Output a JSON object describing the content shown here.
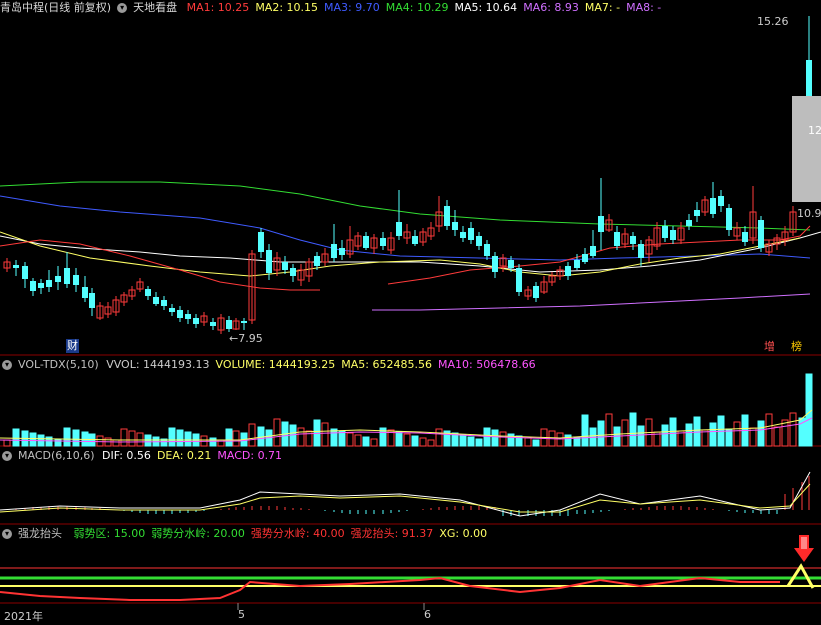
{
  "title_bar": {
    "stock": "青岛中程(日线 前复权)",
    "formula": "天地看盘"
  },
  "main_panel": {
    "ma_items": [
      {
        "text": "MA1: 10.25",
        "color": "#ff3b3b"
      },
      {
        "text": "MA2: 10.15",
        "color": "#ffff66"
      },
      {
        "text": "MA3: 9.70",
        "color": "#3f5bff"
      },
      {
        "text": "MA4: 10.29",
        "color": "#33dd33"
      },
      {
        "text": "MA5: 10.64",
        "color": "#ffffff"
      },
      {
        "text": "MA6: 8.93",
        "color": "#d070ff"
      },
      {
        "text": "MA7: -",
        "color": "#ffff66"
      },
      {
        "text": "MA8: -",
        "color": "#d070ff"
      }
    ],
    "high_label": "15.26",
    "low_label": "7.95",
    "price_box_value": "12",
    "price_right_value": "10.9",
    "badge_cai": "财",
    "badge_zeng": "增",
    "badge_bang": "榜"
  },
  "vol_panel": {
    "name": "VOL-TDX(5,10)",
    "items": [
      {
        "text": "VVOL: 1444193.13",
        "color": "#cccccc"
      },
      {
        "text": "VOLUME: 1444193.25",
        "color": "#ffff66"
      },
      {
        "text": "MA5: 652485.56",
        "color": "#ffff66"
      },
      {
        "text": "MA10: 506478.66",
        "color": "#ff55ff"
      }
    ]
  },
  "macd_panel": {
    "name": "MACD(6,10,6)",
    "items": [
      {
        "text": "DIF: 0.56",
        "color": "#ffffff"
      },
      {
        "text": "DEA: 0.21",
        "color": "#ffff66"
      },
      {
        "text": "MACD: 0.71",
        "color": "#ff55ff"
      }
    ]
  },
  "qlt_panel": {
    "name": "强龙抬头",
    "items": [
      {
        "text": "弱势区: 15.00",
        "color": "#33dd33"
      },
      {
        "text": "弱势分水岭: 20.00",
        "color": "#33dd33"
      },
      {
        "text": "强势分水岭: 40.00",
        "color": "#ff3333"
      },
      {
        "text": "强龙抬头: 91.37",
        "color": "#ff3333"
      },
      {
        "text": "XG: 0.00",
        "color": "#ffff66"
      }
    ]
  },
  "x_axis": {
    "year_label": "2021年",
    "month_5": "5",
    "month_6": "6"
  },
  "colors": {
    "up": "#ff3b3b",
    "down": "#54ffff",
    "grid": "#7a0000",
    "panel_border": "#8b0000"
  }
}
